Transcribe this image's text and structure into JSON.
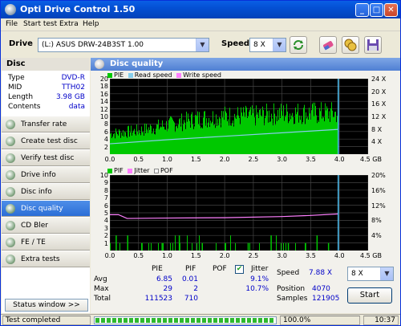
{
  "window": {
    "title": "Opti Drive Control 1.50"
  },
  "menu": [
    "File",
    "Start test",
    "Extra",
    "Help"
  ],
  "toolbar": {
    "drive_label": "Drive",
    "drive_value": "(L:)  ASUS DRW-24B3ST 1.00",
    "speed_label": "Speed",
    "speed_value": "8 X"
  },
  "disc": {
    "header": "Disc",
    "rows": [
      {
        "key": "Type",
        "value": "DVD-R"
      },
      {
        "key": "MID",
        "value": "TTH02"
      },
      {
        "key": "Length",
        "value": "3.98 GB"
      },
      {
        "key": "Contents",
        "value": "data"
      }
    ]
  },
  "nav": [
    {
      "label": "Transfer rate",
      "icon": "transfer-icon"
    },
    {
      "label": "Create test disc",
      "icon": "create-disc-icon"
    },
    {
      "label": "Verify test disc",
      "icon": "verify-disc-icon"
    },
    {
      "label": "Drive info",
      "icon": "drive-info-icon"
    },
    {
      "label": "Disc info",
      "icon": "disc-info-icon"
    },
    {
      "label": "Disc quality",
      "icon": "disc-quality-icon",
      "active": true
    },
    {
      "label": "CD Bler",
      "icon": "cd-bler-icon"
    },
    {
      "label": "FE / TE",
      "icon": "fe-te-icon"
    },
    {
      "label": "Extra tests",
      "icon": "extra-tests-icon"
    }
  ],
  "status_window_btn": "Status window >>",
  "panel": {
    "title": "Disc quality"
  },
  "chart_data": [
    {
      "type": "bar",
      "legend": [
        "PIE",
        "Read speed",
        "Write speed"
      ],
      "legend_colors": [
        "#00c800",
        "#87ceeb",
        "#ff80ff"
      ],
      "xticks": [
        "0.0",
        "0.5",
        "1.0",
        "1.5",
        "2.0",
        "2.5",
        "3.0",
        "3.5",
        "4.0",
        "4.5 GB"
      ],
      "yticks_left": [
        "20",
        "18",
        "16",
        "14",
        "12",
        "10",
        "8",
        "6",
        "4",
        "2"
      ],
      "yticks_right": [
        "24 X",
        "20 X",
        "16 X",
        "12 X",
        "8 X",
        "4 X"
      ],
      "xlim": [
        0,
        4.5
      ],
      "ylim": [
        0,
        20
      ],
      "y2lim": [
        0,
        24
      ],
      "pie_envelope": {
        "x": [
          0.0,
          0.5,
          1.0,
          1.5,
          2.0,
          2.5,
          3.0,
          3.5,
          3.98
        ],
        "y": [
          7,
          8,
          10,
          12,
          13,
          13,
          14,
          14,
          14
        ]
      },
      "read_speed": {
        "x": [
          0.0,
          1.0,
          2.0,
          3.0,
          3.98
        ],
        "y": [
          3.3,
          4.6,
          5.7,
          6.8,
          7.88
        ]
      },
      "end_marker": 3.98
    },
    {
      "type": "bar",
      "legend": [
        "PIF",
        "Jitter",
        "POF"
      ],
      "legend_colors": [
        "#00c800",
        "#ff80ff",
        "#ffffff"
      ],
      "xticks": [
        "0.0",
        "0.5",
        "1.0",
        "1.5",
        "2.0",
        "2.5",
        "3.0",
        "3.5",
        "4.0",
        "4.5 GB"
      ],
      "yticks_left": [
        "10",
        "9",
        "8",
        "7",
        "6",
        "5",
        "4",
        "3",
        "2",
        "1"
      ],
      "yticks_right": [
        "20%",
        "16%",
        "12%",
        "8%",
        "4%"
      ],
      "xlim": [
        0,
        4.5
      ],
      "ylim": [
        0,
        10
      ],
      "y2lim": [
        0,
        20
      ],
      "pif_peaks": {
        "x": [
          0.1,
          0.3,
          0.55,
          0.9,
          1.2,
          1.6,
          2.0,
          2.4,
          2.8,
          3.1,
          3.4,
          3.6,
          3.8
        ],
        "y": [
          2,
          2,
          1,
          1,
          2,
          1,
          1,
          1,
          2,
          1,
          1,
          2,
          1
        ]
      },
      "jitter": {
        "x": [
          0.0,
          0.15,
          0.3,
          1.0,
          2.0,
          3.0,
          3.5,
          3.98
        ],
        "y": [
          9.5,
          9.5,
          8.5,
          8.6,
          8.7,
          9.0,
          9.3,
          9.7
        ]
      },
      "end_marker": 3.98
    }
  ],
  "stats": {
    "headers": [
      "PIE",
      "PIF",
      "POF",
      "Jitter"
    ],
    "rows": [
      {
        "label": "Avg",
        "pie": "6.85",
        "pif": "0.01",
        "jitter": "9.1%"
      },
      {
        "label": "Max",
        "pie": "29",
        "pif": "2",
        "jitter": "10.7%"
      },
      {
        "label": "Total",
        "pie": "111523",
        "pif": "710",
        "jitter": ""
      }
    ],
    "jitter_checked": "✔",
    "speed_label": "Speed",
    "speed_value": "7.88 X",
    "speed_select": "8 X",
    "position_label": "Position",
    "position_value": "4070",
    "samples_label": "Samples",
    "samples_value": "121905",
    "start_label": "Start"
  },
  "statusbar": {
    "text": "Test completed",
    "progress_pct": 100,
    "progress_text": "100.0%",
    "time": "10:37"
  },
  "colors": {
    "pie": "#00c800",
    "read": "#87ceeb",
    "accent_blue": "#0000c8"
  }
}
